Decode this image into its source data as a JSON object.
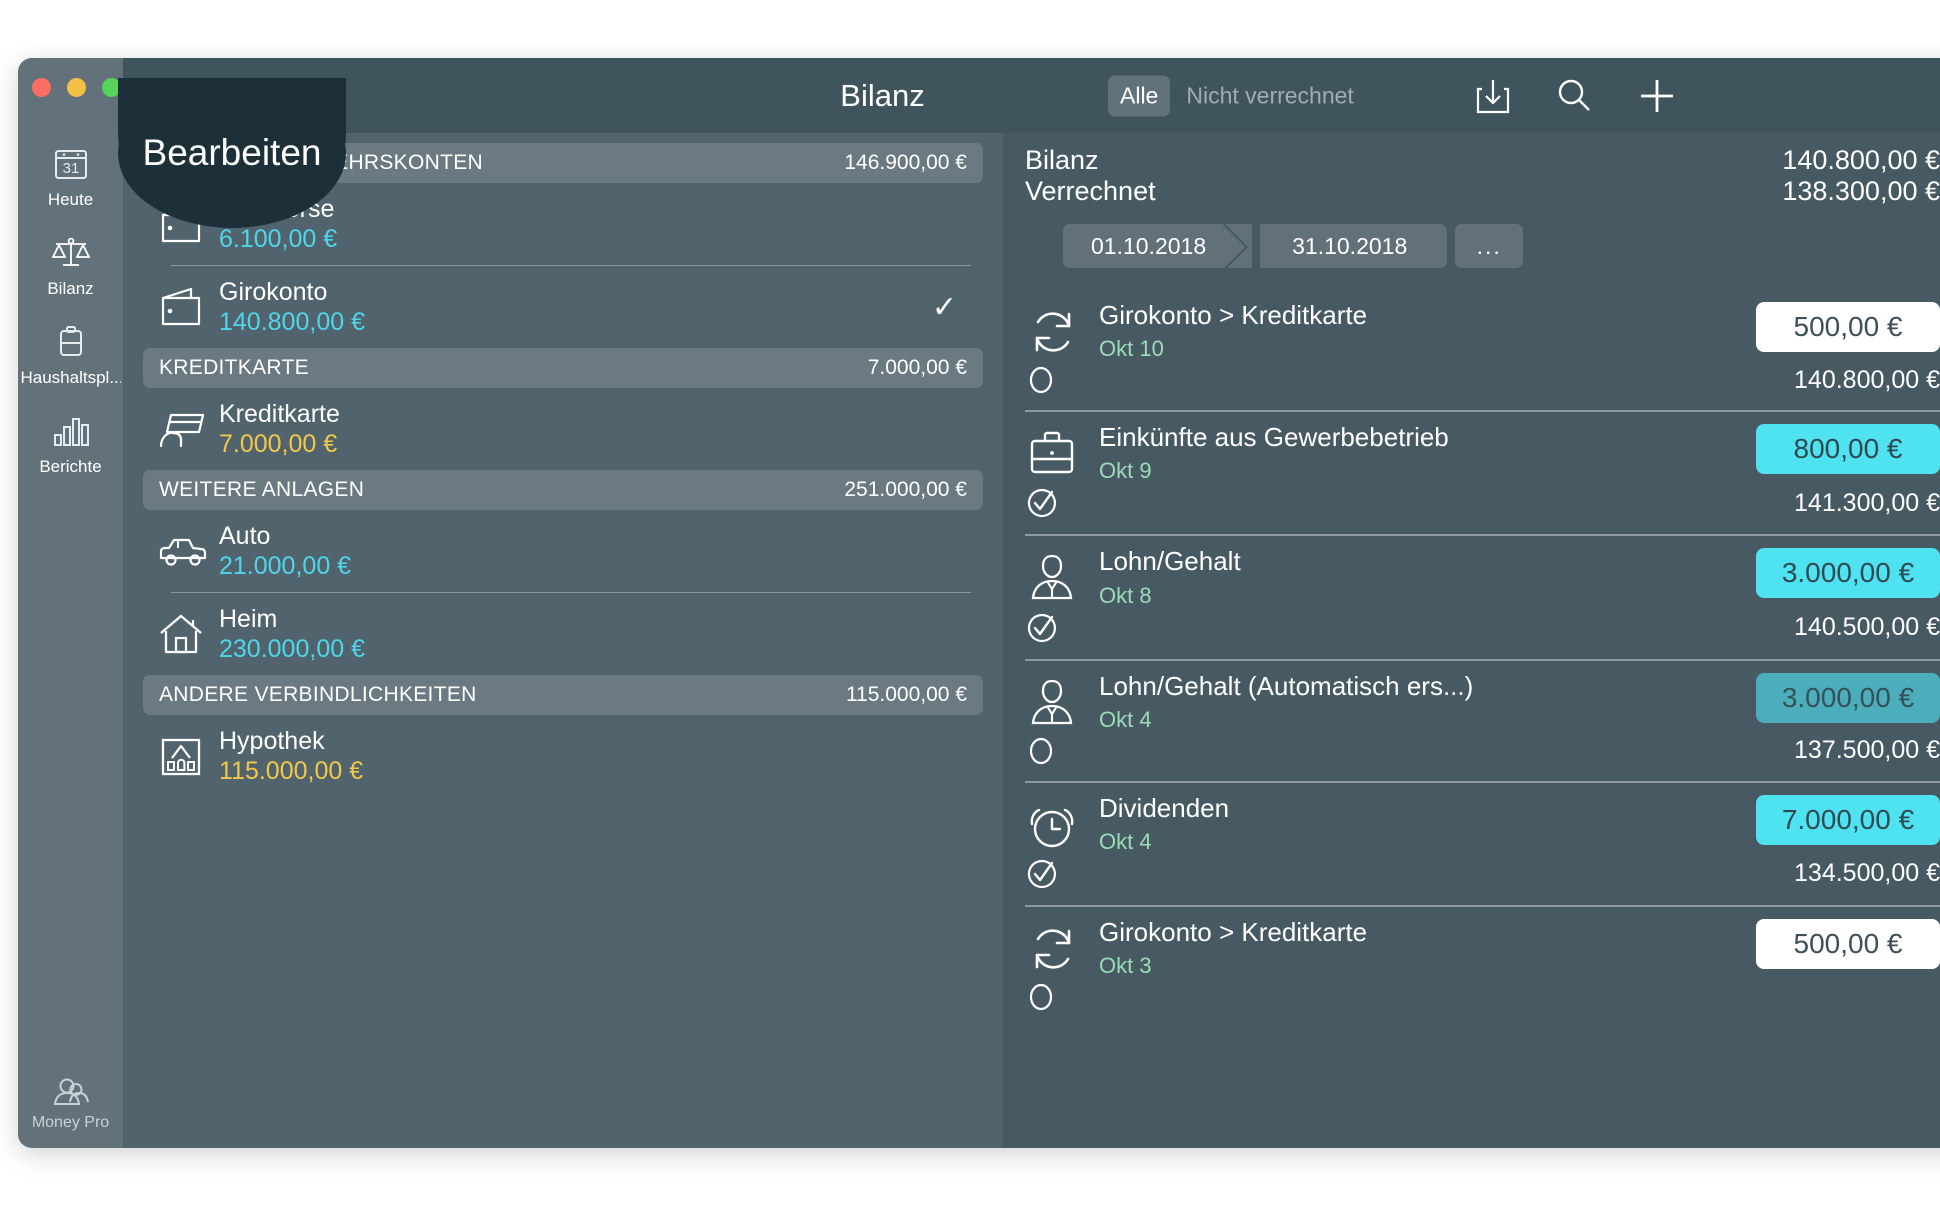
{
  "app": {
    "name": "Money Pro",
    "window_title": "Bilanz"
  },
  "traffic_lights": {
    "close_color": "#fc6d64",
    "minimize_color": "#f5c046",
    "zoom_color": "#55d35a"
  },
  "callout": {
    "label": "Bearbeiten"
  },
  "sidebar": {
    "items": [
      {
        "label": "Heute",
        "icon": "calendar-31-icon"
      },
      {
        "label": "Bilanz",
        "icon": "scales-balance-icon"
      },
      {
        "label": "Haushaltspl...",
        "icon": "wallet-budget-icon"
      },
      {
        "label": "Berichte",
        "icon": "bar-chart-icon"
      }
    ],
    "footer": {
      "label": "Money Pro",
      "icon": "people-icon"
    }
  },
  "toolbar": {
    "title": "Bilanz",
    "segments": [
      {
        "label": "Alle",
        "active": true
      },
      {
        "label": "Nicht verrechnet",
        "active": false
      }
    ],
    "icons": [
      {
        "name": "import-download-icon"
      },
      {
        "name": "search-icon"
      },
      {
        "name": "add-plus-icon"
      }
    ]
  },
  "accounts": {
    "groups": [
      {
        "name": "ZAHLUNGSVERKEHRSKONTEN",
        "total": "146.900,00 €",
        "rows": [
          {
            "name": "Geldbörse",
            "amount": "6.100,00 €",
            "amount_color": "#4fd6ea",
            "icon": "wallet-icon",
            "selected": false
          },
          {
            "name": "Girokonto",
            "amount": "140.800,00 €",
            "amount_color": "#4fd6ea",
            "icon": "wallet-icon",
            "selected": true,
            "check": "✓"
          }
        ]
      },
      {
        "name": "KREDITKARTE",
        "total": "7.000,00 €",
        "rows": [
          {
            "name": "Kreditkarte",
            "amount": "7.000,00 €",
            "amount_color": "#f2c849",
            "icon": "credit-card-hand-icon",
            "selected": false
          }
        ]
      },
      {
        "name": "WEITERE ANLAGEN",
        "total": "251.000,00 €",
        "rows": [
          {
            "name": "Auto",
            "amount": "21.000,00 €",
            "amount_color": "#4fd6ea",
            "icon": "car-icon",
            "selected": false
          },
          {
            "name": "Heim",
            "amount": "230.000,00 €",
            "amount_color": "#4fd6ea",
            "icon": "house-icon",
            "selected": false
          }
        ]
      },
      {
        "name": "ANDERE VERBINDLICHKEITEN",
        "total": "115.000,00 €",
        "rows": [
          {
            "name": "Hypothek",
            "amount": "115.000,00 €",
            "amount_color": "#f2c849",
            "icon": "mortgage-house-icon",
            "selected": false
          }
        ]
      }
    ]
  },
  "register": {
    "summary": [
      {
        "label": "Bilanz",
        "value": "140.800,00 €"
      },
      {
        "label": "Verrechnet",
        "value": "138.300,00 €"
      }
    ],
    "date_range": {
      "from": "01.10.2018",
      "to": "31.10.2018",
      "more": "..."
    },
    "transactions": [
      {
        "title": "Girokonto > Kreditkarte",
        "date": "Okt 10",
        "amount": "500,00 €",
        "amount_style": "white",
        "balance": "140.800,00 €",
        "icon": "transfer-sync-icon",
        "status": "circle-empty-icon"
      },
      {
        "title": "Einkünfte aus Gewerbebetrieb",
        "date": "Okt 9",
        "amount": "800,00 €",
        "amount_style": "cyan",
        "balance": "141.300,00 €",
        "icon": "briefcase-icon",
        "status": "check-circle-icon"
      },
      {
        "title": "Lohn/Gehalt",
        "date": "Okt 8",
        "amount": "3.000,00 €",
        "amount_style": "cyan",
        "balance": "140.500,00 €",
        "icon": "person-suit-icon",
        "status": "check-circle-icon"
      },
      {
        "title": "Lohn/Gehalt (Automatisch ers...)",
        "date": "Okt 4",
        "amount": "3.000,00 €",
        "amount_style": "cyan-dim",
        "balance": "137.500,00 €",
        "icon": "person-suit-icon",
        "status": "circle-empty-icon"
      },
      {
        "title": "Dividenden",
        "date": "Okt 4",
        "amount": "7.000,00 €",
        "amount_style": "cyan",
        "balance": "134.500,00 €",
        "icon": "alarm-clock-icon",
        "status": "check-circle-icon"
      },
      {
        "title": "Girokonto > Kreditkarte",
        "date": "Okt 3",
        "amount": "500,00 €",
        "amount_style": "white",
        "balance": "",
        "icon": "transfer-sync-icon",
        "status": "circle-empty-icon"
      }
    ]
  },
  "colors": {
    "window_bg": "#4e5f68",
    "sidebar_bg": "#63727a",
    "titlebar_bg": "#40545e",
    "accounts_bg": "#51636c",
    "register_bg": "#475a64",
    "accent_cyan": "#4fe2f0",
    "date_green": "#9bdcb7",
    "warning_yellow": "#f2c849"
  }
}
